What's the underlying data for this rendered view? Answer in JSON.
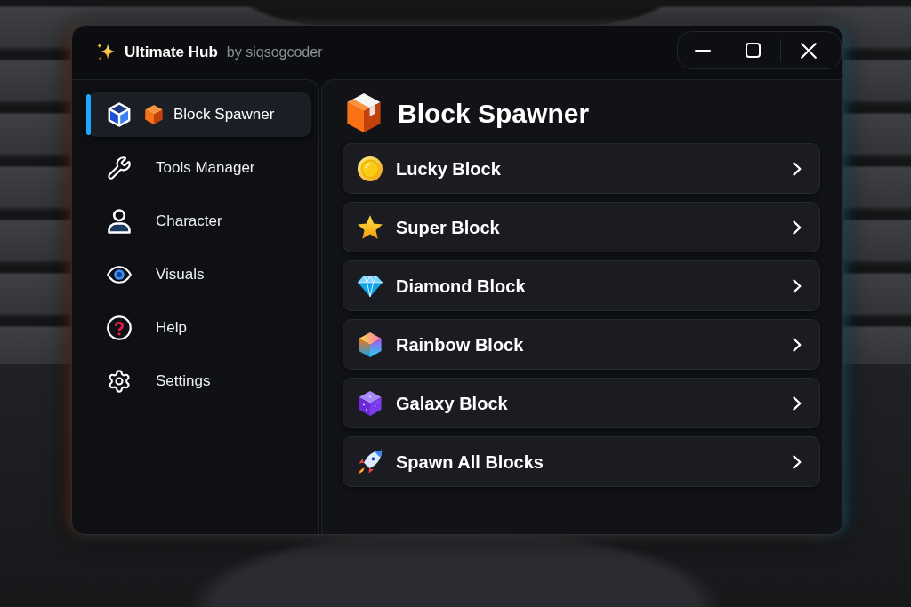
{
  "window": {
    "title": "Ultimate Hub",
    "subtitle": "by siqsogcoder"
  },
  "sidebar": {
    "items": [
      {
        "label": "Block Spawner",
        "selected": true
      },
      {
        "label": "Tools Manager",
        "selected": false
      },
      {
        "label": "Character",
        "selected": false
      },
      {
        "label": "Visuals",
        "selected": false
      },
      {
        "label": "Help",
        "selected": false
      },
      {
        "label": "Settings",
        "selected": false
      }
    ]
  },
  "panel": {
    "title": "Block Spawner",
    "items": [
      {
        "label": "Lucky Block"
      },
      {
        "label": "Super Block"
      },
      {
        "label": "Diamond Block"
      },
      {
        "label": "Rainbow Block"
      },
      {
        "label": "Galaxy Block"
      },
      {
        "label": "Spawn All Blocks"
      }
    ]
  }
}
